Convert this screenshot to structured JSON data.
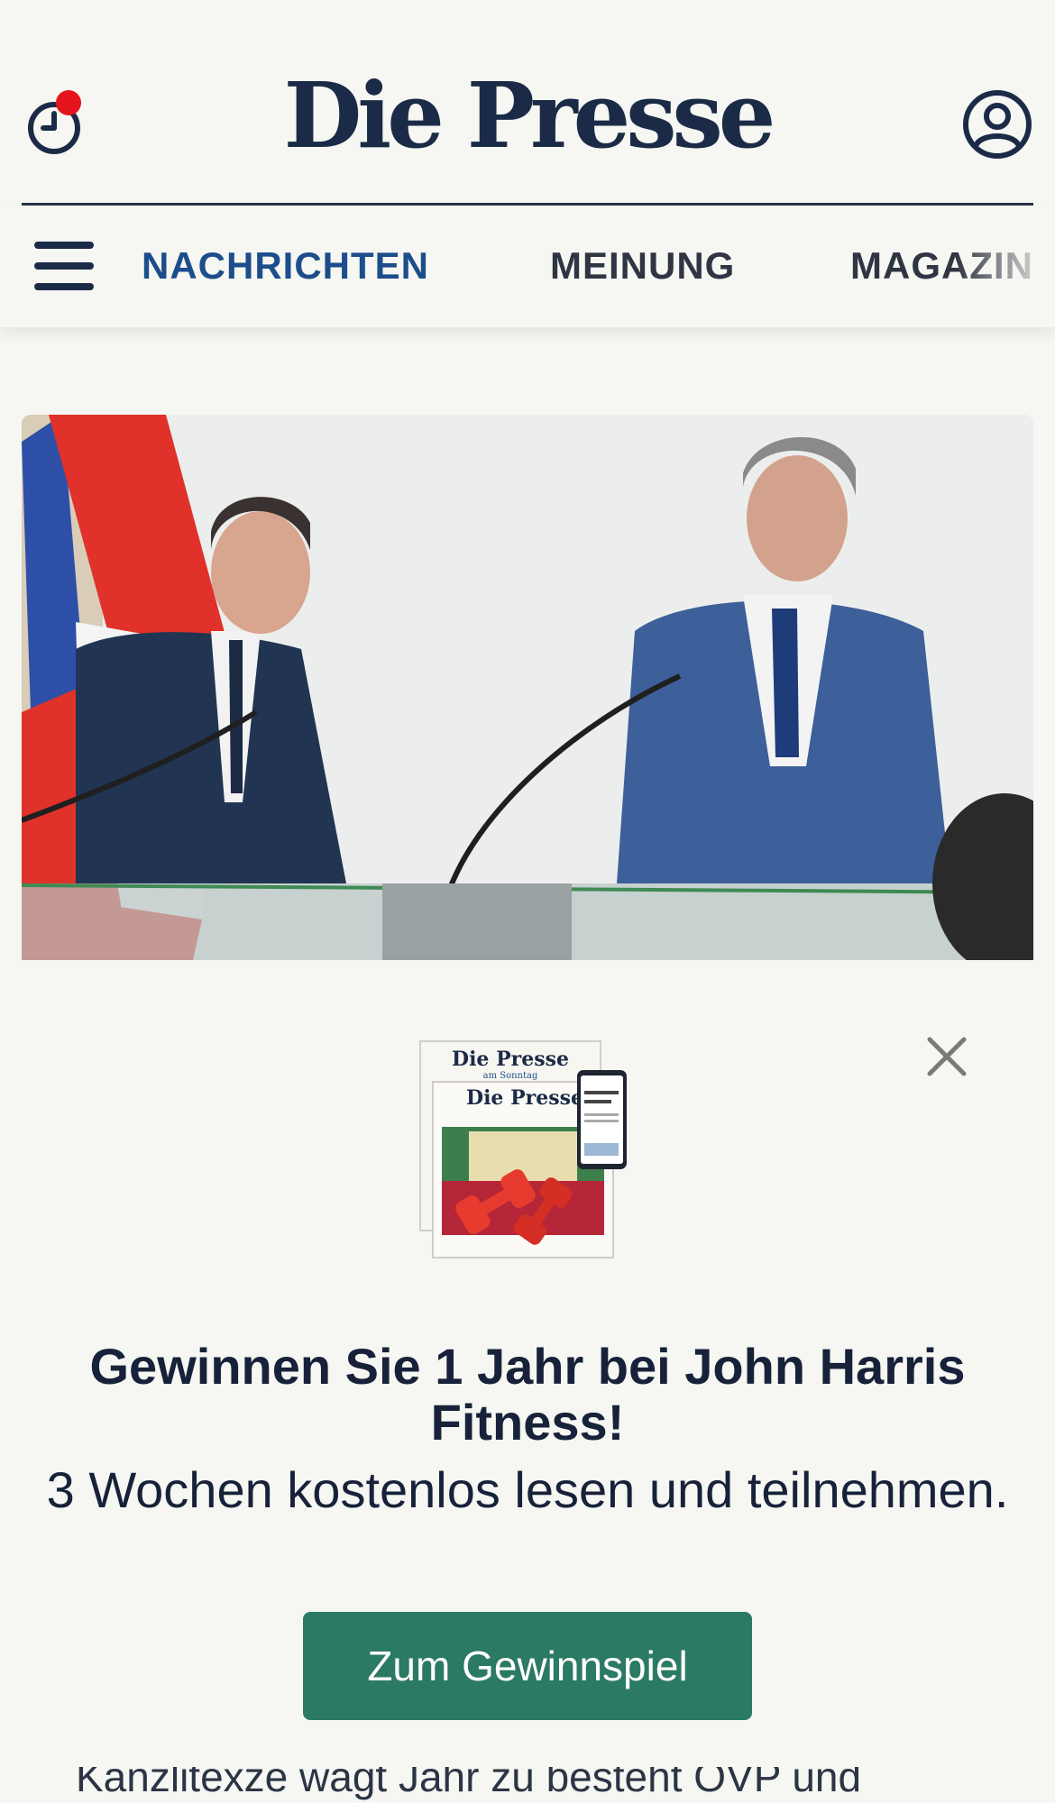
{
  "header": {
    "logo_text": "Die Presse",
    "history_icon": "clock-icon",
    "notification_dot_color": "#e3141c",
    "user_icon": "user-icon"
  },
  "nav": {
    "menu_icon": "hamburger-menu-icon",
    "items": [
      {
        "label": "NACHRICHTEN",
        "active": true
      },
      {
        "label": "MEINUNG",
        "active": false
      },
      {
        "label": "MAGAZIN",
        "active": false
      }
    ],
    "active_color": "#1d4e8c"
  },
  "hero": {
    "image_description_icon": "press-conference-photo"
  },
  "promo": {
    "image_logo_1": "Die Presse",
    "image_logo_1_sub": "am Sonntag",
    "image_logo_2": "Die Presse",
    "headline": "Gewinnen Sie 1 Jahr bei John Harris Fitness!",
    "subline": "3 Wochen kostenlos lesen und teilnehmen.",
    "cta_label": "Zum Gewinnspiel",
    "cta_color": "#2b7a63",
    "close_icon": "close-icon"
  },
  "article_peek": {
    "text": "Kanzlitexze wägt Jahr zu besteht ÖVP und"
  }
}
